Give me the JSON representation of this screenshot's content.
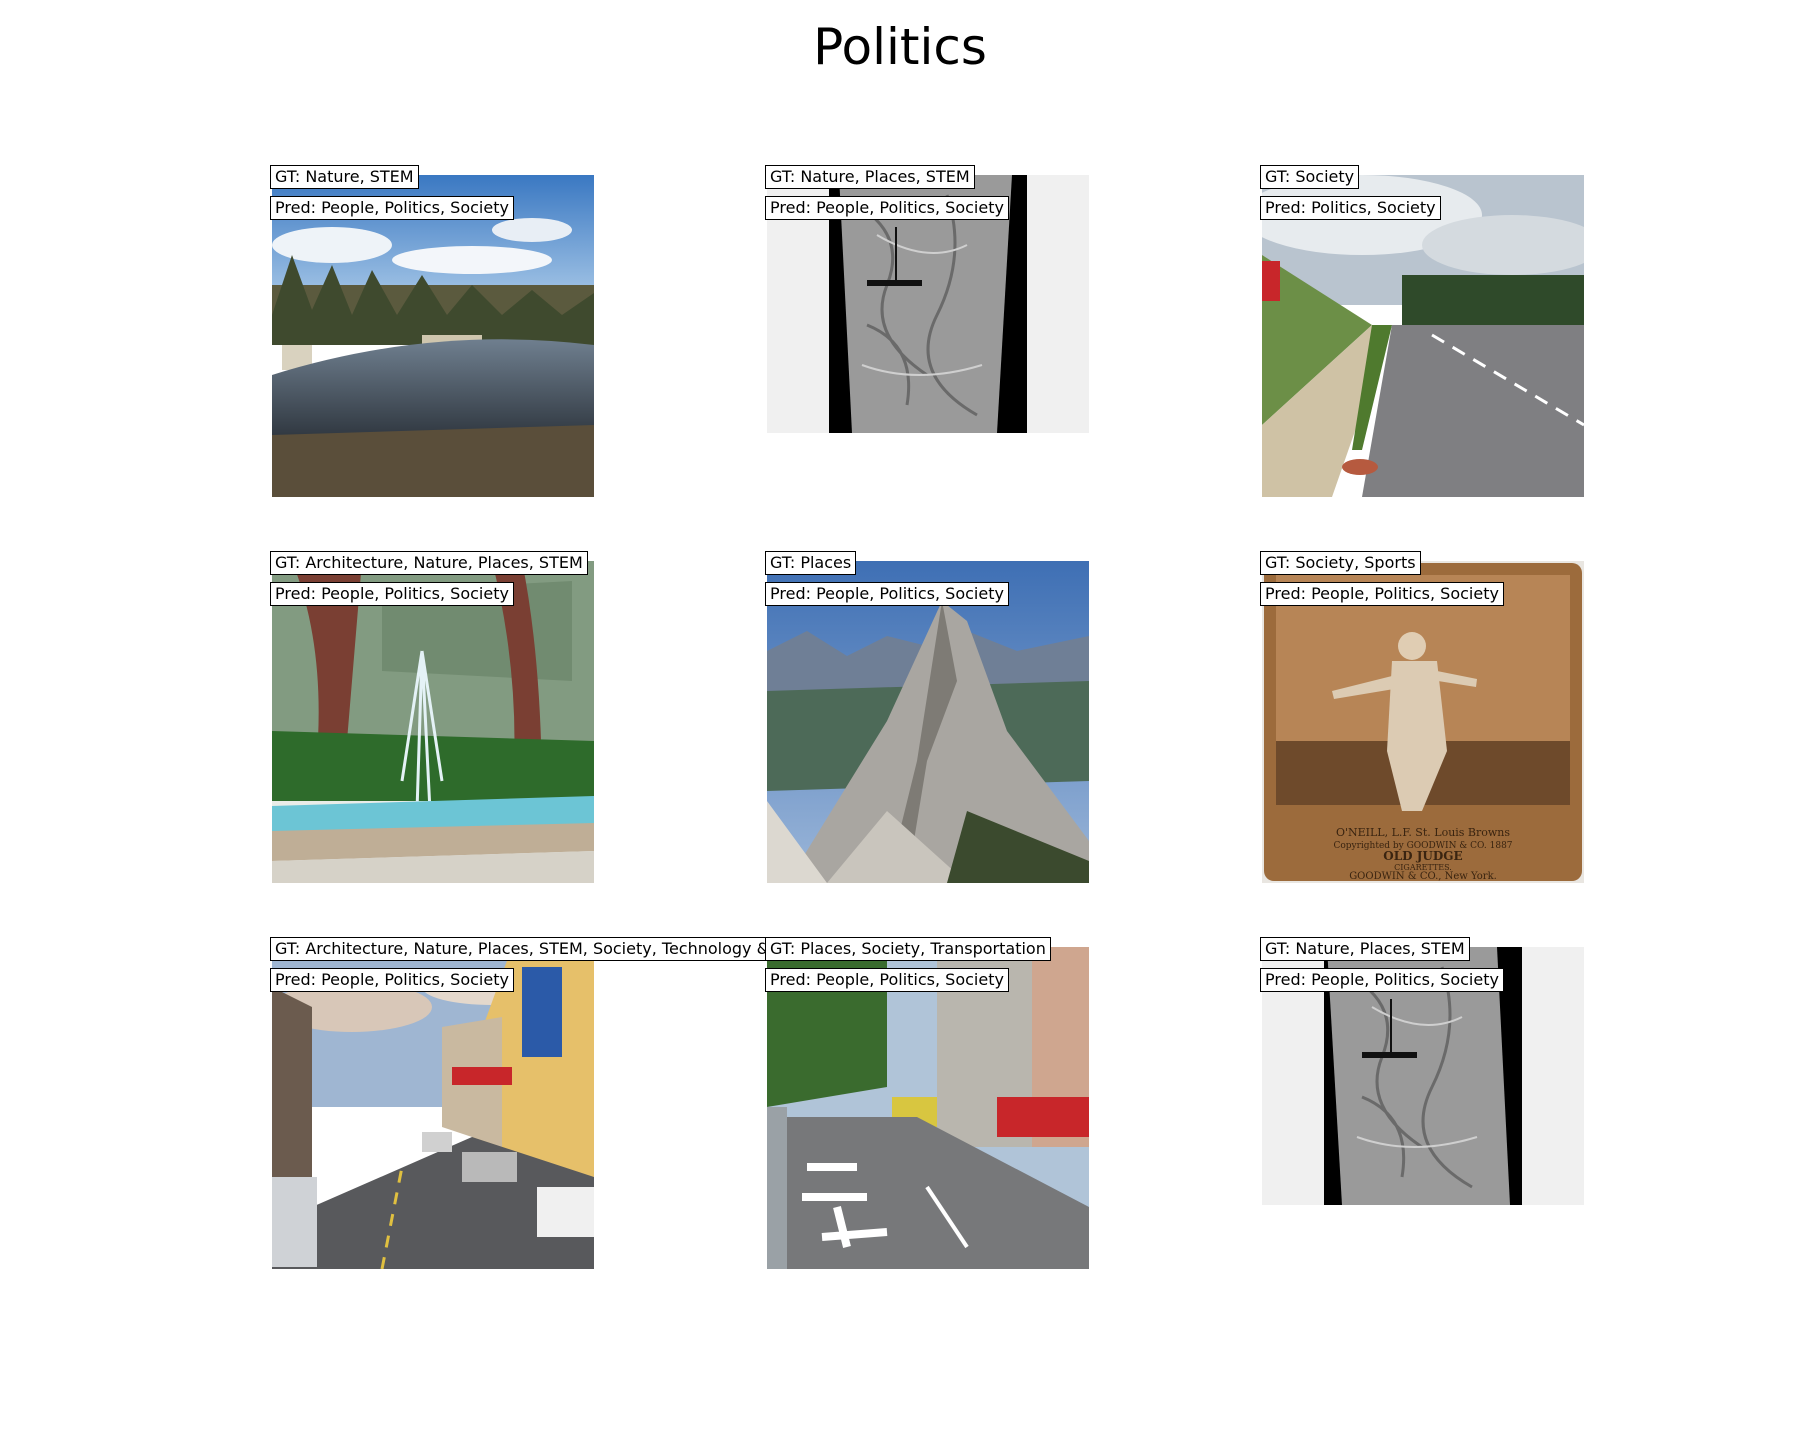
{
  "title": "Politics",
  "panels": [
    {
      "gt": "GT: Nature, STEM",
      "pred": "Pred: People, Politics, Society",
      "scene": "lake with trees and sky"
    },
    {
      "gt": "GT: Nature, Places, STEM",
      "pred": "Pred: People, Politics, Society",
      "scene": "grey relief map strip"
    },
    {
      "gt": "GT: Society",
      "pred": "Pred: Politics, Society",
      "scene": "road with sidewalk"
    },
    {
      "gt": "GT: Architecture, Nature, Places, STEM",
      "pred": "Pred: People, Politics, Society",
      "scene": "garden fountain"
    },
    {
      "gt": "GT: Places",
      "pred": "Pred: People, Politics, Society",
      "scene": "rocky mountain peak"
    },
    {
      "gt": "GT: Society, Sports",
      "pred": "Pred: People, Politics, Society",
      "scene": "vintage baseball card",
      "card_text": [
        "O'NEILL, L.F. St. Louis Browns",
        "Copyrighted by GOODWIN & CO. 1887",
        "OLD JUDGE",
        "CIGARETTES.",
        "GOODWIN & CO., New York."
      ]
    },
    {
      "gt": "GT: Architecture, Nature, Places, STEM, Society, Technology &",
      "pred": "Pred: People, Politics, Society",
      "scene": "busy street with shops"
    },
    {
      "gt": "GT: Places, Society, Transportation",
      "pred": "Pred: People, Politics, Society",
      "scene": "street with road markings"
    },
    {
      "gt": "GT: Nature, Places, STEM",
      "pred": "Pred: People, Politics, Society",
      "scene": "grey relief map strip"
    }
  ]
}
